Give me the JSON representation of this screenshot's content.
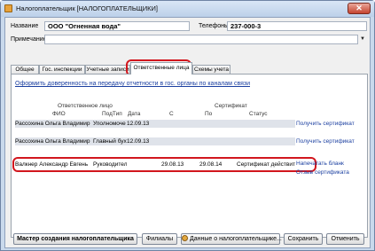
{
  "window": {
    "title": "Налогоплательщик [НАЛОГОПЛАТЕЛЬЩИКИ]",
    "close": "✕"
  },
  "form": {
    "name_label": "Название",
    "name_value": "ООО \"Огненная вода\"",
    "phone_label": "Телефоны",
    "phone_value": "237-000-3",
    "note_label": "Примечание",
    "note_value": ""
  },
  "tabs": [
    {
      "label": "Общее"
    },
    {
      "label": "Гос. инспекции"
    },
    {
      "label": "Учетные записи"
    },
    {
      "label": "Ответственные лица"
    },
    {
      "label": "Схемы учета"
    }
  ],
  "panel": {
    "delegate_link": "Оформить доверенность на передачу отчетности в гос. органы по каналам связи",
    "group_responsible": "Ответственное лицо",
    "group_certificate": "Сертификат",
    "columns": {
      "fio": "ФИО",
      "subtype": "ПодТип",
      "date": "Дата",
      "from": "С",
      "to": "По",
      "status": "Статус"
    },
    "rows": [
      {
        "fio": "Рассохина Ольга Владимир",
        "subtype": "Уполномоче",
        "date": "12.09.13",
        "from": "",
        "to": "",
        "status": "",
        "action1": "Получить сертификат",
        "action2": ""
      },
      {
        "fio": "Рассохина Ольга Владимир",
        "subtype": "Главный бух",
        "date": "12.09.13",
        "from": "",
        "to": "",
        "status": "",
        "action1": "Получить сертификат",
        "action2": ""
      },
      {
        "fio": "Валкнер Александр Евгень",
        "subtype": "Руководител",
        "date": "",
        "from": "29.08.13",
        "to": "29.08.14",
        "status": "Сертификат действителен",
        "action1": "Напечатать бланк",
        "action2": "Отзыв сертификата"
      }
    ]
  },
  "buttons": {
    "wizard": "Мастер создания налогоплательщика",
    "branches": "Филиалы",
    "taxpayer_data": "Данные о налогоплательщике...",
    "save": "Сохранить",
    "cancel": "Отменить"
  },
  "colors": {
    "highlight": "#d2171e",
    "link": "#1b3fa0"
  }
}
